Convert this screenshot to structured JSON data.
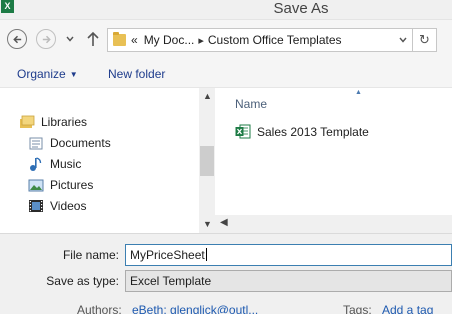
{
  "window": {
    "title": "Save As",
    "app_icon": "X"
  },
  "nav": {
    "back_icon": "back-arrow-icon",
    "forward_icon": "forward-arrow-icon",
    "up_icon": "up-arrow-icon"
  },
  "address": {
    "overflow": "«",
    "crumbs": [
      "My Doc...",
      "Custom Office Templates"
    ],
    "refresh_icon": "refresh-icon"
  },
  "toolbar": {
    "organize_label": "Organize",
    "new_folder_label": "New folder"
  },
  "tree": {
    "items": [
      {
        "label": "Libraries",
        "icon": "libraries-icon"
      },
      {
        "label": "Documents",
        "icon": "documents-icon"
      },
      {
        "label": "Music",
        "icon": "music-icon"
      },
      {
        "label": "Pictures",
        "icon": "pictures-icon"
      },
      {
        "label": "Videos",
        "icon": "videos-icon"
      }
    ]
  },
  "files": {
    "column_header": "Name",
    "rows": [
      {
        "name": "Sales 2013 Template",
        "icon": "excel-template-icon"
      }
    ]
  },
  "form": {
    "file_name_label": "File name:",
    "file_name_value": "MyPriceSheet",
    "save_as_type_label": "Save as type:",
    "save_as_type_value": "Excel Template",
    "authors_label": "Authors:",
    "authors_value": "eBeth; glenglick@outl...",
    "tags_label": "Tags:",
    "tags_value": "Add a tag"
  },
  "colors": {
    "link": "#1e5ab0",
    "excel_green": "#1d7b45",
    "input_focus": "#3c7fb1"
  }
}
